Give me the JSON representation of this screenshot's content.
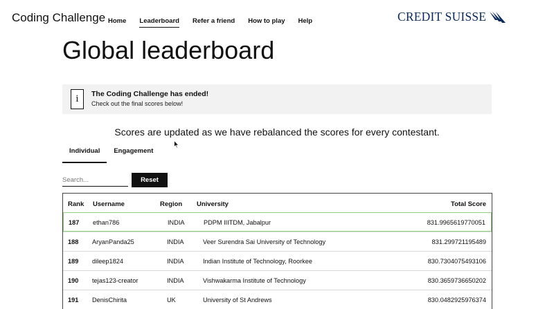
{
  "header": {
    "brand": "Coding Challenge",
    "nav": [
      "Home",
      "Leaderboard",
      "Refer a friend",
      "How to play",
      "Help"
    ],
    "active_nav": "Leaderboard",
    "logo_text": "CREDIT SUISSE"
  },
  "page": {
    "title": "Global leaderboard",
    "notice_title": "The Coding Challenge has ended!",
    "notice_subtitle": "Check out the final scores below!",
    "notice_icon": "i",
    "update_message": "Scores are updated as we have rebalanced the scores for every contestant."
  },
  "tabs": [
    "Individual",
    "Engagement"
  ],
  "active_tab": "Individual",
  "search": {
    "placeholder": "Search..."
  },
  "reset_label": "Reset",
  "table": {
    "headers": [
      "Rank",
      "Username",
      "Region",
      "University",
      "Total Score"
    ],
    "rows": [
      {
        "rank": "187",
        "username": "ethan786",
        "region": "INDIA",
        "university": "PDPM IIITDM, Jabalpur",
        "score": "831.9965619770051"
      },
      {
        "rank": "188",
        "username": "AryanPanda25",
        "region": "INDIA",
        "university": "Veer Surendra Sai University of Technology",
        "score": "831.299721195489"
      },
      {
        "rank": "189",
        "username": "dileep1824",
        "region": "INDIA",
        "university": "Indian Institute of Technology, Roorkee",
        "score": "830.7304075493106"
      },
      {
        "rank": "190",
        "username": "tejas123-creator",
        "region": "INDIA",
        "university": "Vishwakarma Institute of Technology",
        "score": "830.3659736650202"
      },
      {
        "rank": "191",
        "username": "DenisChirita",
        "region": "UK",
        "university": "University of St Andrews",
        "score": "830.0482925976374"
      }
    ]
  },
  "colors": {
    "logo": "#0b2a5b",
    "highlight_border": "#8fd47a",
    "notice_bg": "#f2f2f2",
    "button_bg": "#111111"
  }
}
